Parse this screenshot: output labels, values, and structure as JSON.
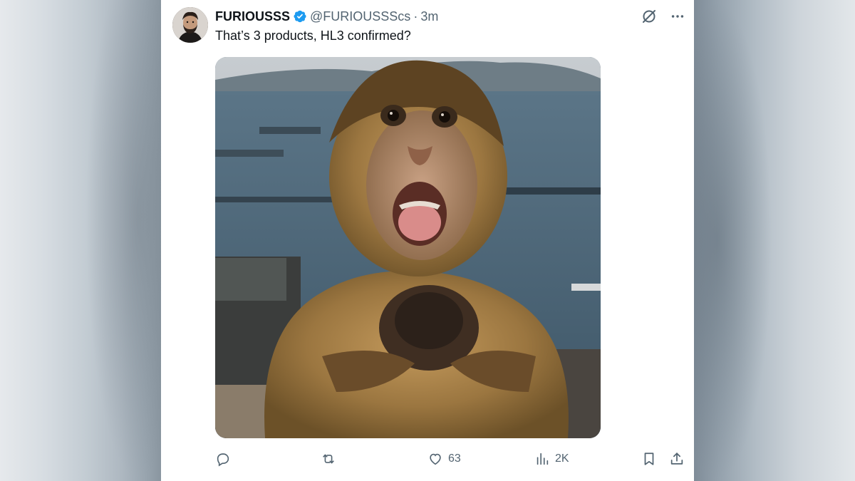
{
  "tweet": {
    "author_name": "FURIOUSSS",
    "handle": "@FURIOUSSScs",
    "separator": "·",
    "time": "3m",
    "text": "That’s 3 products, HL3 confirmed?",
    "media_description_icon": "image-photo"
  },
  "icons": {
    "avatar": "avatar-photo",
    "verified": "verified-badge-icon",
    "grok": "grok-icon",
    "more": "more-icon",
    "reply": "reply-icon",
    "retweet": "retweet-icon",
    "like": "heart-icon",
    "views": "views-icon",
    "bookmark": "bookmark-icon",
    "share": "share-icon"
  },
  "actions": {
    "reply_count": "",
    "retweet_count": "",
    "like_count": "63",
    "view_count": "2K"
  },
  "colors": {
    "verified": "#1d9bf0",
    "text": "#0f1419",
    "muted": "#536471"
  }
}
